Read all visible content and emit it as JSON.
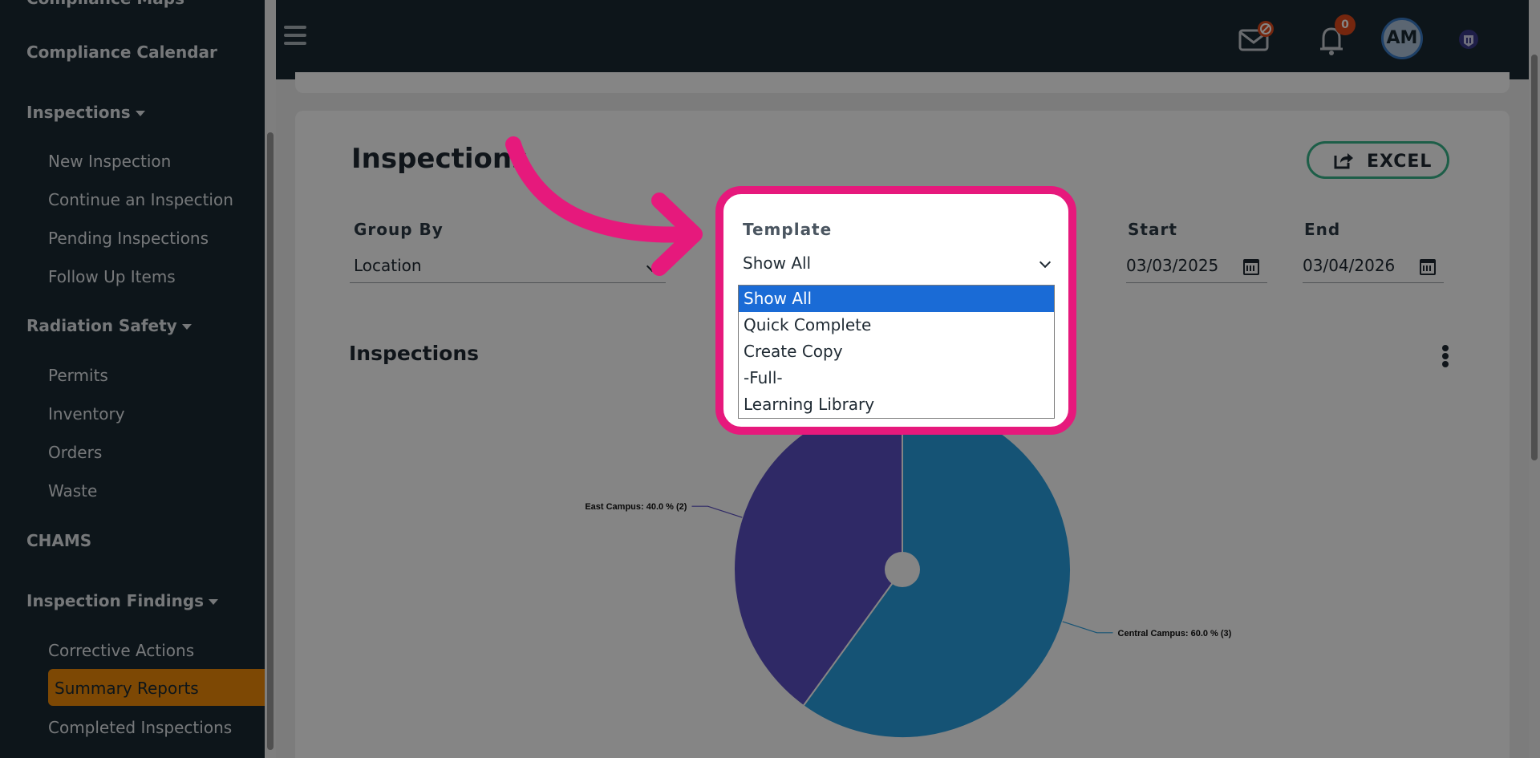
{
  "sidebar": {
    "top_fragment": "Compliance Maps",
    "items": [
      {
        "label": "Compliance Calendar"
      },
      {
        "label": "Inspections"
      },
      {
        "label": "New Inspection"
      },
      {
        "label": "Continue an Inspection"
      },
      {
        "label": "Pending Inspections"
      },
      {
        "label": "Follow Up Items"
      },
      {
        "label": "Radiation Safety"
      },
      {
        "label": "Permits"
      },
      {
        "label": "Inventory"
      },
      {
        "label": "Orders"
      },
      {
        "label": "Waste"
      },
      {
        "label": "CHAMS"
      },
      {
        "label": "Inspection Findings"
      },
      {
        "label": "Corrective Actions"
      },
      {
        "label": "Summary Reports"
      },
      {
        "label": "Completed Inspections"
      }
    ]
  },
  "header": {
    "notification_count": "0",
    "avatar_initials": "AM"
  },
  "page": {
    "title": "Inspections",
    "excel_label": "EXCEL",
    "section_title": "Inspections"
  },
  "filters": {
    "group_by_label": "Group By",
    "group_by_value": "Location",
    "template_label": "Template",
    "template_value": "Show All",
    "template_options": [
      "Show All",
      "Quick Complete",
      "Create Copy",
      "-Full-",
      "Learning Library"
    ],
    "start_label": "Start",
    "start_value": "03/03/2025",
    "end_label": "End",
    "end_value": "03/04/2026"
  },
  "chart_data": {
    "type": "pie",
    "slices": [
      {
        "name": "Central Campus",
        "value": 3,
        "percent": 60.0,
        "color": "#2a9fe0"
      },
      {
        "name": "East Campus",
        "value": 2,
        "percent": 40.0,
        "color": "#5b4fc4"
      }
    ],
    "labels": [
      "Central Campus: 60.0 % (3)",
      "East Campus: 40.0 % (2)"
    ]
  },
  "colors": {
    "sidebar_bg": "#1a2a33",
    "active_item": "#f08a08",
    "highlight": "#e6197c",
    "excel_border": "#39b58a",
    "option_selected": "#1a6bd6"
  }
}
